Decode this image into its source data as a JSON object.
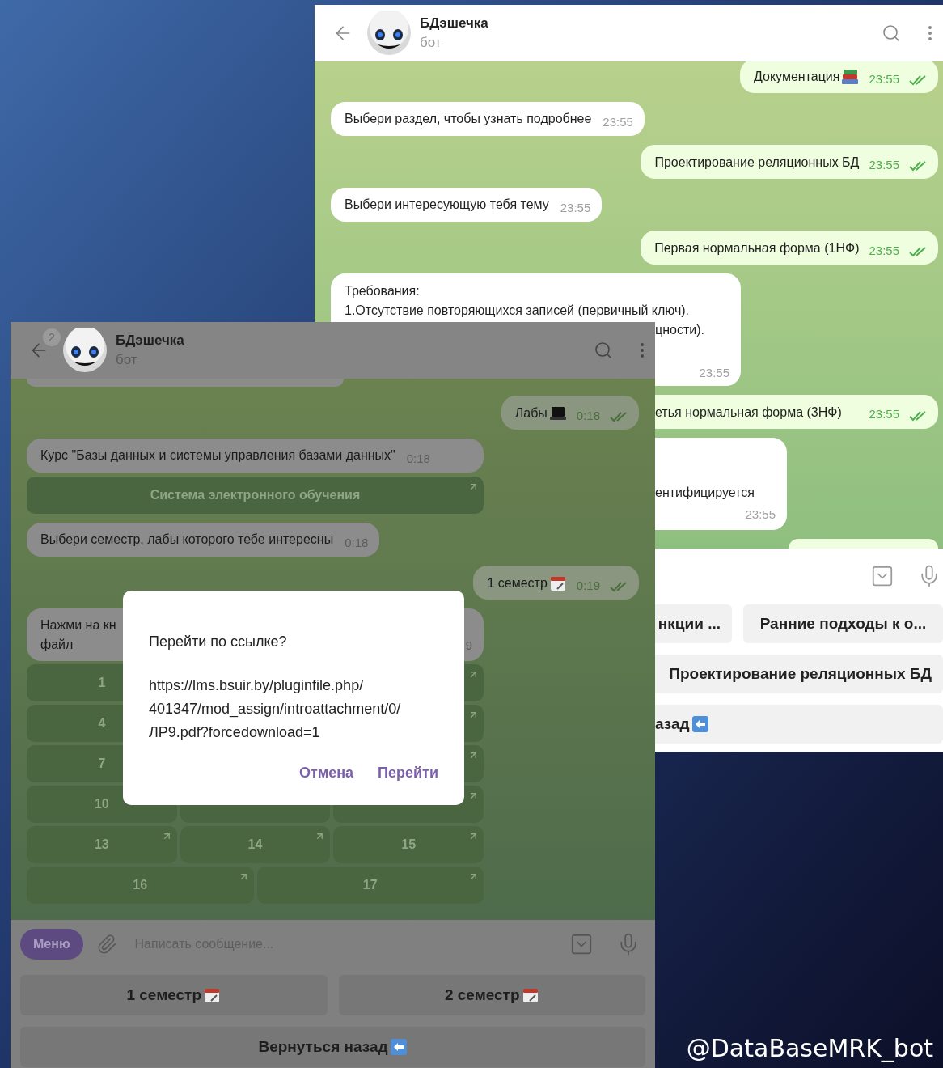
{
  "caption": "@DataBaseMRK_bot",
  "back_window": {
    "title": "БДэшечка",
    "subtitle": "бот",
    "messages": [
      {
        "kind": "out",
        "text": "Документация",
        "time": "23:55",
        "read": true,
        "covered_left": false
      },
      {
        "kind": "in",
        "text": "Выбери раздел, чтобы узнать подробнее",
        "time": "23:55",
        "covered_left": false
      },
      {
        "kind": "out",
        "text": "Проектирование реляционных БД",
        "time": "23:55",
        "read": true,
        "covered_left": false
      },
      {
        "kind": "in",
        "text": "Выбери интересующую тебя тему",
        "time": "23:55",
        "covered_left": false
      },
      {
        "kind": "out",
        "text": "Первая нормальная форма (1НФ)",
        "time": "23:55",
        "read": true,
        "covered_left": false
      },
      {
        "kind": "multiline",
        "lines": [
          {
            "text": "Требования:",
            "covered_left": false
          },
          {
            "text": "1.Отсутствие повторяющихся записей (первичный ключ).",
            "covered_left": false
          },
          {
            "text": "цности).",
            "covered_left": true
          }
        ],
        "time": "23:55"
      },
      {
        "kind": "out",
        "text": "етья нормальная форма (3НФ)",
        "time": "23:55",
        "read": true,
        "covered_left": true
      },
      {
        "kind": "in",
        "text": "ентифицируется",
        "time": "23:55",
        "covered_left": true
      },
      {
        "kind": "cut_off"
      }
    ],
    "keyboard": [
      [
        {
          "label": "нкции ...",
          "covered_left": true
        },
        {
          "label": "Ранние подходы к о...",
          "covered_left": false
        }
      ],
      [
        {
          "label": "Проектирование реляционных БД",
          "covered_left": true
        }
      ],
      [
        {
          "label": "азад",
          "covered_left": true
        }
      ]
    ]
  },
  "front_window": {
    "title": "БДэшечка",
    "subtitle": "бот",
    "unread_badge": "2",
    "messages": [
      {
        "kind": "cut_off"
      },
      {
        "kind": "out",
        "text": "Лабы",
        "time": "0:18",
        "read": true,
        "covered_left": false
      },
      {
        "kind": "in",
        "text": "Курс \"Базы данных и системы управления базами данных\"",
        "time": "0:18",
        "covered_left": false,
        "buttons": [
          [
            "Система электронного обучения"
          ]
        ]
      },
      {
        "kind": "in",
        "text": "Выбери семестр, лабы которого тебе интересны",
        "time": "0:18",
        "covered_left": false
      },
      {
        "kind": "out",
        "text": "1 семестр",
        "time": "0:19",
        "read": true,
        "covered_left": false
      },
      {
        "kind": "covered_middle",
        "lines": [
          "Нажми на кн",
          "файл"
        ],
        "time": "9",
        "buttons": [
          [
            "1"
          ],
          [
            "4"
          ],
          [
            "7"
          ],
          [
            "10"
          ],
          [
            "13",
            "14",
            "15"
          ],
          [
            "16",
            "17"
          ]
        ]
      }
    ],
    "input": {
      "menu": "Меню",
      "placeholder": "Написать сообщение..."
    },
    "keyboard": [
      [
        {
          "label": "1 семестр"
        },
        {
          "label": "2 семестр"
        }
      ],
      [
        {
          "label": "Вернуться назад"
        }
      ]
    ],
    "dialog": {
      "title": "Перейти по ссылке?",
      "url_lines": [
        "https://lms.bsuir.by/pluginfile.php/",
        "401347/mod_assign/introattachment/0/",
        "ЛР9.pdf?forcedownload=1"
      ],
      "buttons": [
        "Отмена",
        "Перейти"
      ]
    }
  }
}
